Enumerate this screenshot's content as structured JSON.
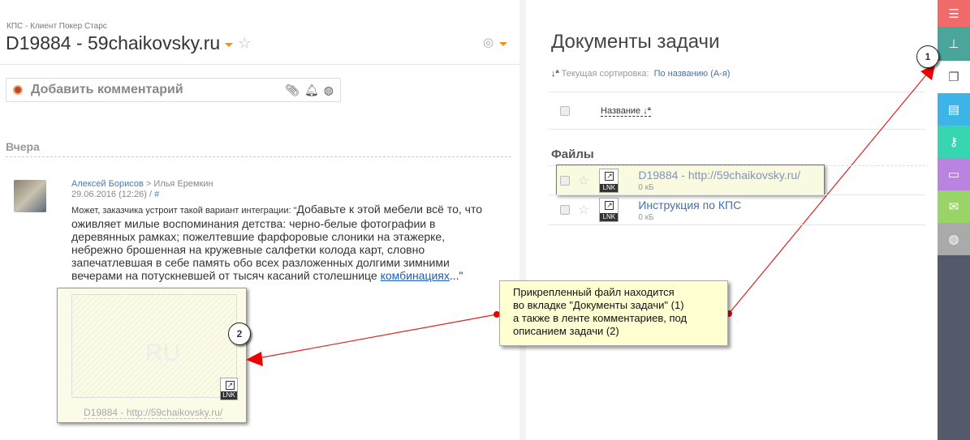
{
  "header": {
    "breadcrumb": "КПС - Клиент Покер Старс",
    "title": "D19884 - 59chaikovsky.ru"
  },
  "comment_box": {
    "placeholder": "Добавить комментарий"
  },
  "feed": {
    "day": "Вчера",
    "author": "Алексей Борисов",
    "separator": ">",
    "recipient": "Илья Еремкин",
    "date": "29.06.2016 (12:26)",
    "slash": "/",
    "hash": "#",
    "intro": "Может, заказчика устроит такой вариант интеграции: \"",
    "text": "Добавьте к этой мебели всё то, что оживляет милые воспоминания детства: черно-белые фотографии в деревянных рамках; пожелтевшие фарфоровые слоники на этажерке, небрежно брошенная на кружевные салфетки колода карт, словно запечатлевшая в себе память обо всех разложенных долгими зимними вечерами на потускневшей от тысяч касаний столешнице ",
    "link": "комбинациях",
    "tail": "...\"",
    "attachment": {
      "caption": "D19884 - http://59chaikovsky.ru/",
      "type": "LNK",
      "watermark": "RU"
    }
  },
  "docs": {
    "title": "Документы задачи",
    "sort_label": "Текущая сортировка:",
    "sort_value": "По названию (А-я)",
    "column": "Название",
    "section": "Файлы",
    "files": [
      {
        "name": "D19884 - http://59chaikovsky.ru/",
        "size": "0 кБ",
        "type": "LNK"
      },
      {
        "name": "Инструкция по КПС",
        "size": "0 кБ",
        "type": "LNK"
      }
    ]
  },
  "annotation": {
    "lines": [
      "Прикрепленный файл находится",
      "во вкладке \"Документы задачи\" (1)",
      "а также в ленте комментариев, под",
      "описанием задачи (2)"
    ],
    "callout1": "1",
    "callout2": "2"
  },
  "sidebar": [
    {
      "icon": "list-icon",
      "color": "#f06a6a"
    },
    {
      "icon": "sitemap-icon",
      "color": "#4aa59a"
    },
    {
      "icon": "copy-icon",
      "color": "#ffffff"
    },
    {
      "icon": "document-icon",
      "color": "#3cb4e8"
    },
    {
      "icon": "key-icon",
      "color": "#36d6b0"
    },
    {
      "icon": "inbox-icon",
      "color": "#b884e0"
    },
    {
      "icon": "mail-icon",
      "color": "#98d468"
    },
    {
      "icon": "circle-wave-icon",
      "color": "#aaaaaa"
    }
  ]
}
